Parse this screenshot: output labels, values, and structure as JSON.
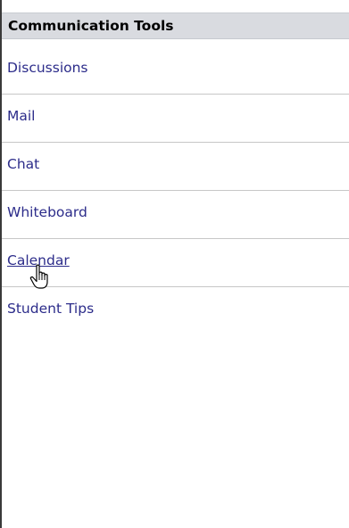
{
  "panel": {
    "title": "Communication Tools"
  },
  "tools": [
    {
      "label": "Discussions"
    },
    {
      "label": "Mail"
    },
    {
      "label": "Chat"
    },
    {
      "label": "Whiteboard"
    },
    {
      "label": "Calendar"
    },
    {
      "label": "Student Tips"
    }
  ],
  "cursor": {
    "icon": "hand-pointer-icon"
  },
  "colors": {
    "header_bg": "#d9dbe0",
    "link": "#2c2c8a",
    "divider": "#c7c7c7"
  }
}
